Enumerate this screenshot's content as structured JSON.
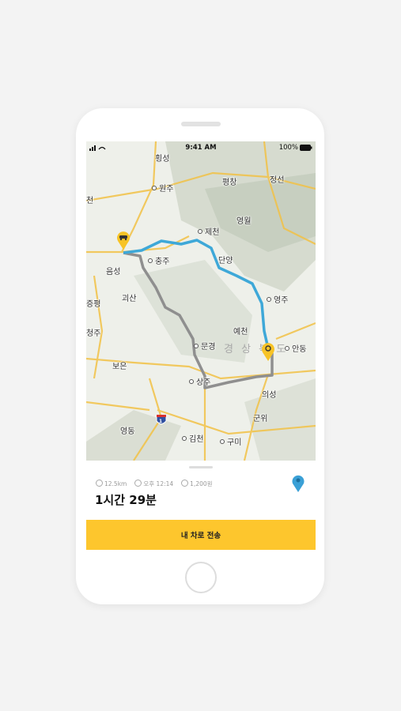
{
  "status_bar": {
    "time": "9:41 AM",
    "battery": "100%"
  },
  "map": {
    "places": [
      {
        "name": "횡성"
      },
      {
        "name": "원주"
      },
      {
        "name": "평창"
      },
      {
        "name": "정선"
      },
      {
        "name": "천"
      },
      {
        "name": "제천"
      },
      {
        "name": "영월"
      },
      {
        "name": "충주"
      },
      {
        "name": "단양"
      },
      {
        "name": "음성"
      },
      {
        "name": "괴산"
      },
      {
        "name": "증평"
      },
      {
        "name": "영주"
      },
      {
        "name": "청주"
      },
      {
        "name": "예천"
      },
      {
        "name": "문경"
      },
      {
        "name": "안동"
      },
      {
        "name": "보은"
      },
      {
        "name": "상주"
      },
      {
        "name": "의성"
      },
      {
        "name": "군위"
      },
      {
        "name": "영동"
      },
      {
        "name": "김천"
      },
      {
        "name": "구미"
      }
    ],
    "region_label": "경 상 북 도",
    "highway_shield": "1",
    "route_colors": {
      "primary": "#3ea8d8",
      "alternate": "#8f8f8f"
    },
    "marker_color": "#f7c326"
  },
  "route_info": {
    "distance": "12.5km",
    "arrival": "오후 12:14",
    "toll": "1,200원",
    "duration": "1시간 29분"
  },
  "actions": {
    "send_to_car": "내 차로 전송"
  },
  "colors": {
    "accent": "#fdc62d",
    "pin": "#3aa0d6"
  }
}
